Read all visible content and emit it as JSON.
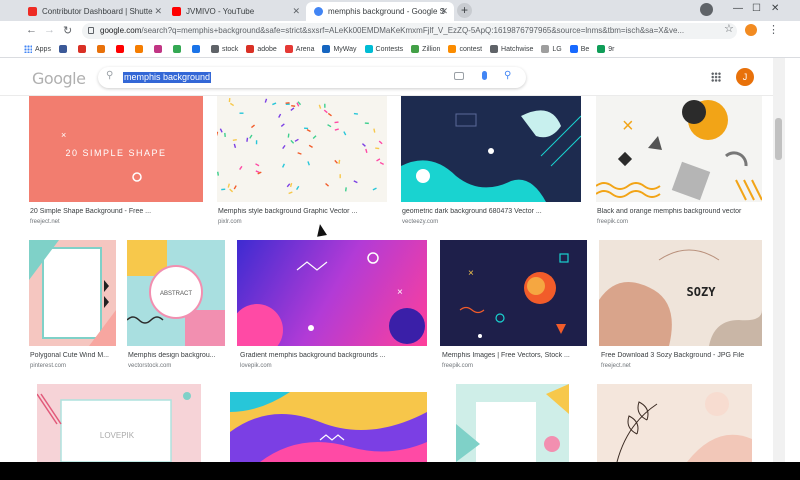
{
  "tabs": [
    {
      "title": "Contributor Dashboard | Shutte",
      "favicon_color": "#ee2b24",
      "active": false
    },
    {
      "title": "JVMIVO - YouTube",
      "favicon_color": "#ff0000",
      "active": false
    },
    {
      "title": "memphis background - Google S",
      "favicon_color": "#4285f4",
      "active": true
    }
  ],
  "address_bar": {
    "url_host": "google.com",
    "url_path": "/search?q=memphis+background&safe=strict&sxsrf=ALeKk00EMDMaKeKmxmFjlf_V_EzZQ-5ApQ:1619876797965&source=lnms&tbm=isch&sa=X&ve..."
  },
  "bookmarks": [
    {
      "label": "Apps",
      "icon": "apps-grid-icon",
      "color": "#4285f4"
    },
    {
      "label": "",
      "icon": "p-icon",
      "color": "#3b5998"
    },
    {
      "label": "",
      "icon": "gmail-icon",
      "color": "#d93025"
    },
    {
      "label": "",
      "icon": "red-icon",
      "color": "#e8710a"
    },
    {
      "label": "",
      "icon": "youtube-icon",
      "color": "#ff0000"
    },
    {
      "label": "",
      "icon": "blogger-icon",
      "color": "#f57d00"
    },
    {
      "label": "",
      "icon": "instagram-icon",
      "color": "#c13584"
    },
    {
      "label": "",
      "icon": "drive-icon",
      "color": "#34a853"
    },
    {
      "label": "",
      "icon": "s-icon",
      "color": "#1a73e8"
    },
    {
      "label": "stock",
      "icon": "gear-icon",
      "color": "#5f6368"
    },
    {
      "label": "adobe",
      "icon": "adobe-icon",
      "color": "#d93025"
    },
    {
      "label": "Arena",
      "icon": "arena-icon",
      "color": "#e53935"
    },
    {
      "label": "MyWay",
      "icon": "myway-icon",
      "color": "#1565c0"
    },
    {
      "label": "Contests",
      "icon": "contests-icon",
      "color": "#00bcd4"
    },
    {
      "label": "Zillion",
      "icon": "zillion-icon",
      "color": "#43a047"
    },
    {
      "label": "contest",
      "icon": "contest-icon",
      "color": "#fb8c00"
    },
    {
      "label": "Hatchwise",
      "icon": "hatchwise-icon",
      "color": "#5f6368"
    },
    {
      "label": "LG",
      "icon": "lg-icon",
      "color": "#9e9e9e"
    },
    {
      "label": "Be",
      "icon": "behance-icon",
      "color": "#1769ff"
    },
    {
      "label": "9r",
      "icon": "9r-icon",
      "color": "#0f9d58"
    }
  ],
  "google": {
    "logo": "Google",
    "query": "memphis background",
    "avatar_letter": "J"
  },
  "results": [
    {
      "caption": "20 Simple Shape Background - Free ...",
      "source": "freeject.net",
      "thumb_text": "20 SIMPLE SHAPE",
      "bg": "#f27d6f"
    },
    {
      "caption": "Memphis style background Graphic Vector ...",
      "source": "pixlr.com",
      "thumb_text": "",
      "bg": "#f7f5ef"
    },
    {
      "caption": "geometric dark background 680473 Vector ...",
      "source": "vecteezy.com",
      "thumb_text": "",
      "bg": "#1d2b4f"
    },
    {
      "caption": "Black and orange memphis background vector",
      "source": "freepik.com",
      "thumb_text": "",
      "bg": "#f4f4f2"
    },
    {
      "caption": "Polygonal Cute Wind M...",
      "source": "pinterest.com",
      "thumb_text": "",
      "bg": "#f5c6c0"
    },
    {
      "caption": "Memphis design backgrou...",
      "source": "vectorstock.com",
      "thumb_text": "ABSTRACT",
      "bg": "#a9dfe0"
    },
    {
      "caption": "Gradient memphis background backgrounds ...",
      "source": "lovepik.com",
      "thumb_text": "",
      "bg": "#6a3ee0"
    },
    {
      "caption": "Memphis Images | Free Vectors, Stock ...",
      "source": "freepik.com",
      "thumb_text": "",
      "bg": "#1e1f4a"
    },
    {
      "caption": "Free Download 3 Sozy Background - JPG File",
      "source": "freeject.net",
      "thumb_text": "SOZY",
      "bg": "#efe4da"
    },
    {
      "caption": "",
      "source": "",
      "thumb_text": "LOVEPIK",
      "bg": "#f6d3d7"
    },
    {
      "caption": "",
      "source": "",
      "thumb_text": "",
      "bg": "#f7c64a"
    },
    {
      "caption": "",
      "source": "",
      "thumb_text": "",
      "bg": "#cfeee8"
    },
    {
      "caption": "",
      "source": "",
      "thumb_text": "",
      "bg": "#f4e6dc"
    }
  ]
}
